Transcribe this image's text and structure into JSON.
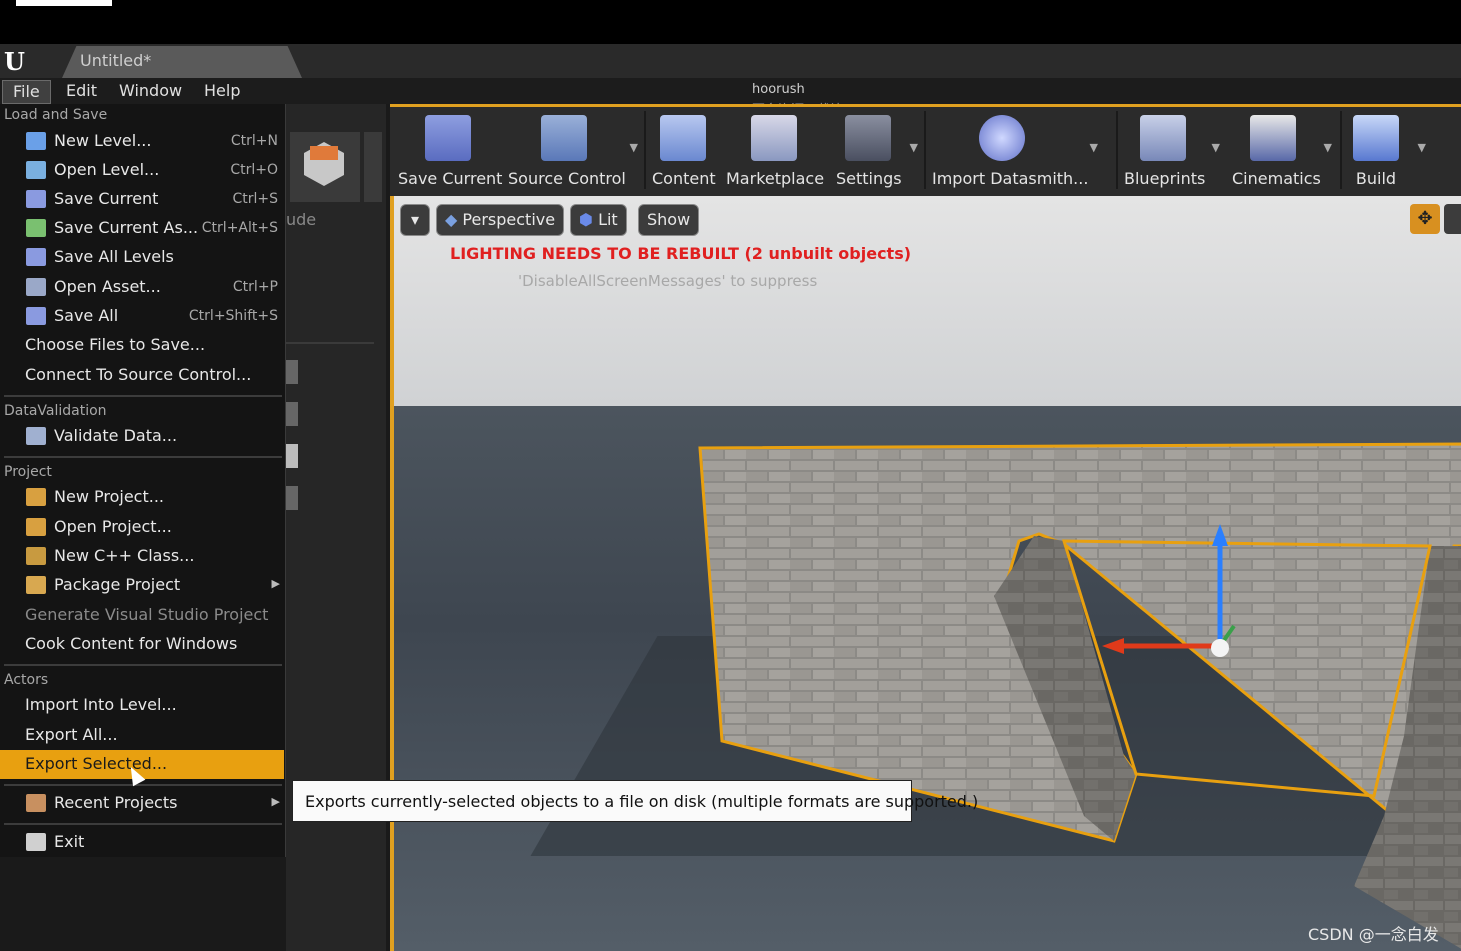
{
  "window": {
    "tab_title": "Untitled*"
  },
  "menubar": {
    "items": [
      "File",
      "Edit",
      "Window",
      "Help"
    ]
  },
  "overlay": {
    "user": "hoorush",
    "watermark": "更多资源下载让app：CandyGoona"
  },
  "left_panel": {
    "partial_text": "ude"
  },
  "toolbar": {
    "buttons": [
      {
        "label": "Save Current",
        "icon": "floppy-disk-icon"
      },
      {
        "label": "Source Control",
        "icon": "source-control-icon"
      },
      {
        "label": "Content",
        "icon": "content-grid-icon"
      },
      {
        "label": "Marketplace",
        "icon": "marketplace-bag-icon"
      },
      {
        "label": "Settings",
        "icon": "gears-icon"
      },
      {
        "label": "Import Datasmith...",
        "icon": "datasmith-icon"
      },
      {
        "label": "Blueprints",
        "icon": "gamepad-icon"
      },
      {
        "label": "Cinematics",
        "icon": "clapperboard-icon"
      },
      {
        "label": "Build",
        "icon": "build-blocks-icon"
      }
    ]
  },
  "viewport": {
    "perspective": "Perspective",
    "lit": "Lit",
    "show": "Show",
    "warning": "LIGHTING NEEDS TO BE REBUILT (2 unbuilt objects)",
    "hint": "'DisableAllScreenMessages' to suppress"
  },
  "file_menu": {
    "sections": {
      "load_and_save": "Load and Save",
      "data_validation": "DataValidation",
      "project": "Project",
      "actors": "Actors"
    },
    "items": {
      "new_level": {
        "label": "New Level...",
        "shortcut": "Ctrl+N"
      },
      "open_level": {
        "label": "Open Level...",
        "shortcut": "Ctrl+O"
      },
      "save_current": {
        "label": "Save Current",
        "shortcut": "Ctrl+S"
      },
      "save_current_as": {
        "label": "Save Current As...",
        "shortcut": "Ctrl+Alt+S"
      },
      "save_all_levels": {
        "label": "Save All Levels"
      },
      "open_asset": {
        "label": "Open Asset...",
        "shortcut": "Ctrl+P"
      },
      "save_all": {
        "label": "Save All",
        "shortcut": "Ctrl+Shift+S"
      },
      "choose_files": {
        "label": "Choose Files to Save..."
      },
      "connect_source": {
        "label": "Connect To Source Control..."
      },
      "validate_data": {
        "label": "Validate Data..."
      },
      "new_project": {
        "label": "New Project..."
      },
      "open_project": {
        "label": "Open Project..."
      },
      "new_cpp": {
        "label": "New C++ Class..."
      },
      "package_project": {
        "label": "Package Project"
      },
      "gen_vs": {
        "label": "Generate Visual Studio Project"
      },
      "cook_content": {
        "label": "Cook Content for Windows"
      },
      "import_level": {
        "label": "Import Into Level..."
      },
      "export_all": {
        "label": "Export All..."
      },
      "export_selected": {
        "label": "Export Selected..."
      },
      "recent_projects": {
        "label": "Recent Projects"
      },
      "exit": {
        "label": "Exit"
      }
    }
  },
  "tooltip": {
    "text": "Exports currently-selected objects to a file on disk (multiple formats are supported.)"
  },
  "footer": {
    "credit": "CSDN @一念白发"
  },
  "colors": {
    "accent": "#e8a010",
    "warning": "#e02020"
  }
}
